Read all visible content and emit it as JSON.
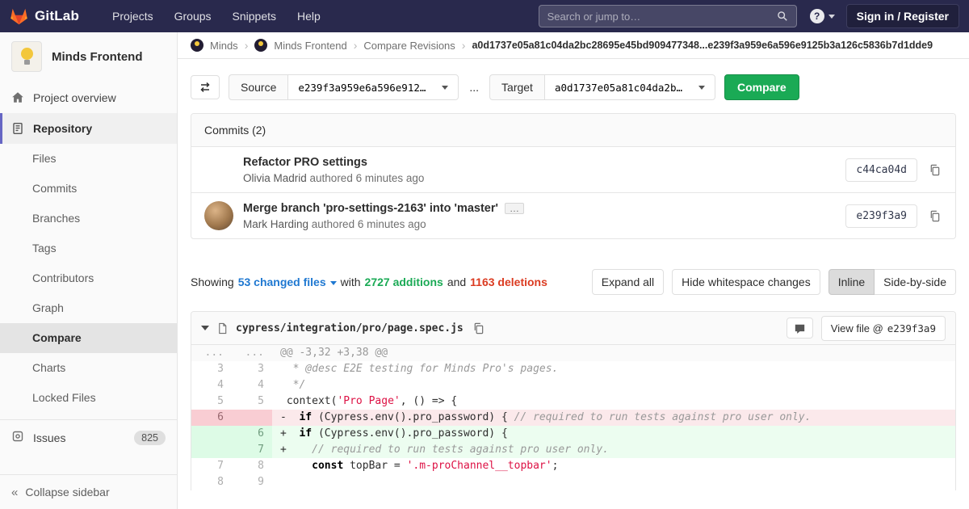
{
  "colors": {
    "navbar_bg": "#29294d",
    "accent_purple": "#6666c4",
    "link_blue": "#1f78d1",
    "additions_green": "#1aaa55",
    "deletions_red": "#db3b21"
  },
  "navbar": {
    "brand": "GitLab",
    "menu": [
      "Projects",
      "Groups",
      "Snippets",
      "Help"
    ],
    "search_placeholder": "Search or jump to…",
    "help_glyph": "?",
    "sign_in_label": "Sign in / Register"
  },
  "sidebar": {
    "project_name": "Minds Frontend",
    "project_overview_label": "Project overview",
    "repository_label": "Repository",
    "repo_items": [
      {
        "label": "Files",
        "active": false
      },
      {
        "label": "Commits",
        "active": false
      },
      {
        "label": "Branches",
        "active": false
      },
      {
        "label": "Tags",
        "active": false
      },
      {
        "label": "Contributors",
        "active": false
      },
      {
        "label": "Graph",
        "active": false
      },
      {
        "label": "Compare",
        "active": true
      },
      {
        "label": "Charts",
        "active": false
      },
      {
        "label": "Locked Files",
        "active": false
      }
    ],
    "issues_label": "Issues",
    "issues_count": "825",
    "collapse_label": "Collapse sidebar",
    "collapse_glyph": "«"
  },
  "breadcrumb": {
    "items": [
      {
        "label": "Minds",
        "avatar": true
      },
      {
        "label": "Minds Frontend",
        "avatar": true
      },
      {
        "label": "Compare Revisions",
        "avatar": false
      }
    ],
    "separator": "›",
    "current": "a0d1737e05a81c04da2bc28695e45bd909477348...e239f3a959e6a596e9125b3a126c5836b7d1dde9"
  },
  "compare_form": {
    "source_label": "Source",
    "source_value": "e239f3a959e6a596e912…",
    "separator": "...",
    "target_label": "Target",
    "target_value": "a0d1737e05a81c04da2b…",
    "compare_button": "Compare"
  },
  "commits": {
    "header": "Commits (2)",
    "items": [
      {
        "title": "Refactor PRO settings",
        "expander": null,
        "author": "Olivia Madrid",
        "authored": " authored 6 minutes ago",
        "sha": "c44ca04d"
      },
      {
        "title": "Merge branch 'pro-settings-2163' into 'master'",
        "expander": "…",
        "author": "Mark Harding",
        "authored": " authored 6 minutes ago",
        "sha": "e239f3a9"
      }
    ]
  },
  "summary": {
    "showing": "Showing",
    "files_link": "53 changed files",
    "with_text": "with",
    "additions": "2727 additions",
    "and_text": "and",
    "deletions": "1163 deletions",
    "expand_all": "Expand all",
    "hide_whitespace": "Hide whitespace changes",
    "view_modes": [
      {
        "label": "Inline",
        "active": true
      },
      {
        "label": "Side-by-side",
        "active": false
      }
    ]
  },
  "diff": {
    "file_path": "cypress/integration/pro/page.spec.js",
    "view_file_label": "View file @",
    "view_file_sha": "e239f3a9",
    "lines": [
      {
        "old": "...",
        "new": "...",
        "type": "hunk",
        "sign": "",
        "segments": [
          {
            "text": "@@ -3,32 +3,38 @@",
            "cls": "plain"
          }
        ]
      },
      {
        "old": "3",
        "new": "3",
        "type": "context",
        "sign": " ",
        "segments": [
          {
            "text": " * @desc E2E testing for Minds Pro's pages.",
            "cls": "comment"
          }
        ]
      },
      {
        "old": "4",
        "new": "4",
        "type": "context",
        "sign": " ",
        "segments": [
          {
            "text": " */",
            "cls": "comment"
          }
        ]
      },
      {
        "old": "5",
        "new": "5",
        "type": "context",
        "sign": " ",
        "segments": [
          {
            "text": "context(",
            "cls": "plain"
          },
          {
            "text": "'Pro Page'",
            "cls": "string"
          },
          {
            "text": ", () => {",
            "cls": "plain"
          }
        ]
      },
      {
        "old": "6",
        "new": "",
        "type": "removed",
        "sign": "-",
        "segments": [
          {
            "text": "  ",
            "cls": "plain"
          },
          {
            "text": "if",
            "cls": "keyword"
          },
          {
            "text": " (Cypress.env().pro_password) { ",
            "cls": "plain"
          },
          {
            "text": "// required to run tests against pro user only.",
            "cls": "comment"
          }
        ]
      },
      {
        "old": "",
        "new": "6",
        "type": "added",
        "sign": "+",
        "segments": [
          {
            "text": "  ",
            "cls": "plain"
          },
          {
            "text": "if",
            "cls": "keyword"
          },
          {
            "text": " (Cypress.env().pro_password) {",
            "cls": "plain"
          }
        ]
      },
      {
        "old": "",
        "new": "7",
        "type": "added",
        "sign": "+",
        "segments": [
          {
            "text": "    ",
            "cls": "plain"
          },
          {
            "text": "// required to run tests against pro user only.",
            "cls": "comment"
          }
        ]
      },
      {
        "old": "7",
        "new": "8",
        "type": "context",
        "sign": " ",
        "segments": [
          {
            "text": "    ",
            "cls": "plain"
          },
          {
            "text": "const",
            "cls": "keyword"
          },
          {
            "text": " topBar = ",
            "cls": "plain"
          },
          {
            "text": "'.m-proChannel__topbar'",
            "cls": "string"
          },
          {
            "text": ";",
            "cls": "plain"
          }
        ]
      },
      {
        "old": "8",
        "new": "9",
        "type": "context",
        "sign": " ",
        "segments": []
      }
    ]
  }
}
